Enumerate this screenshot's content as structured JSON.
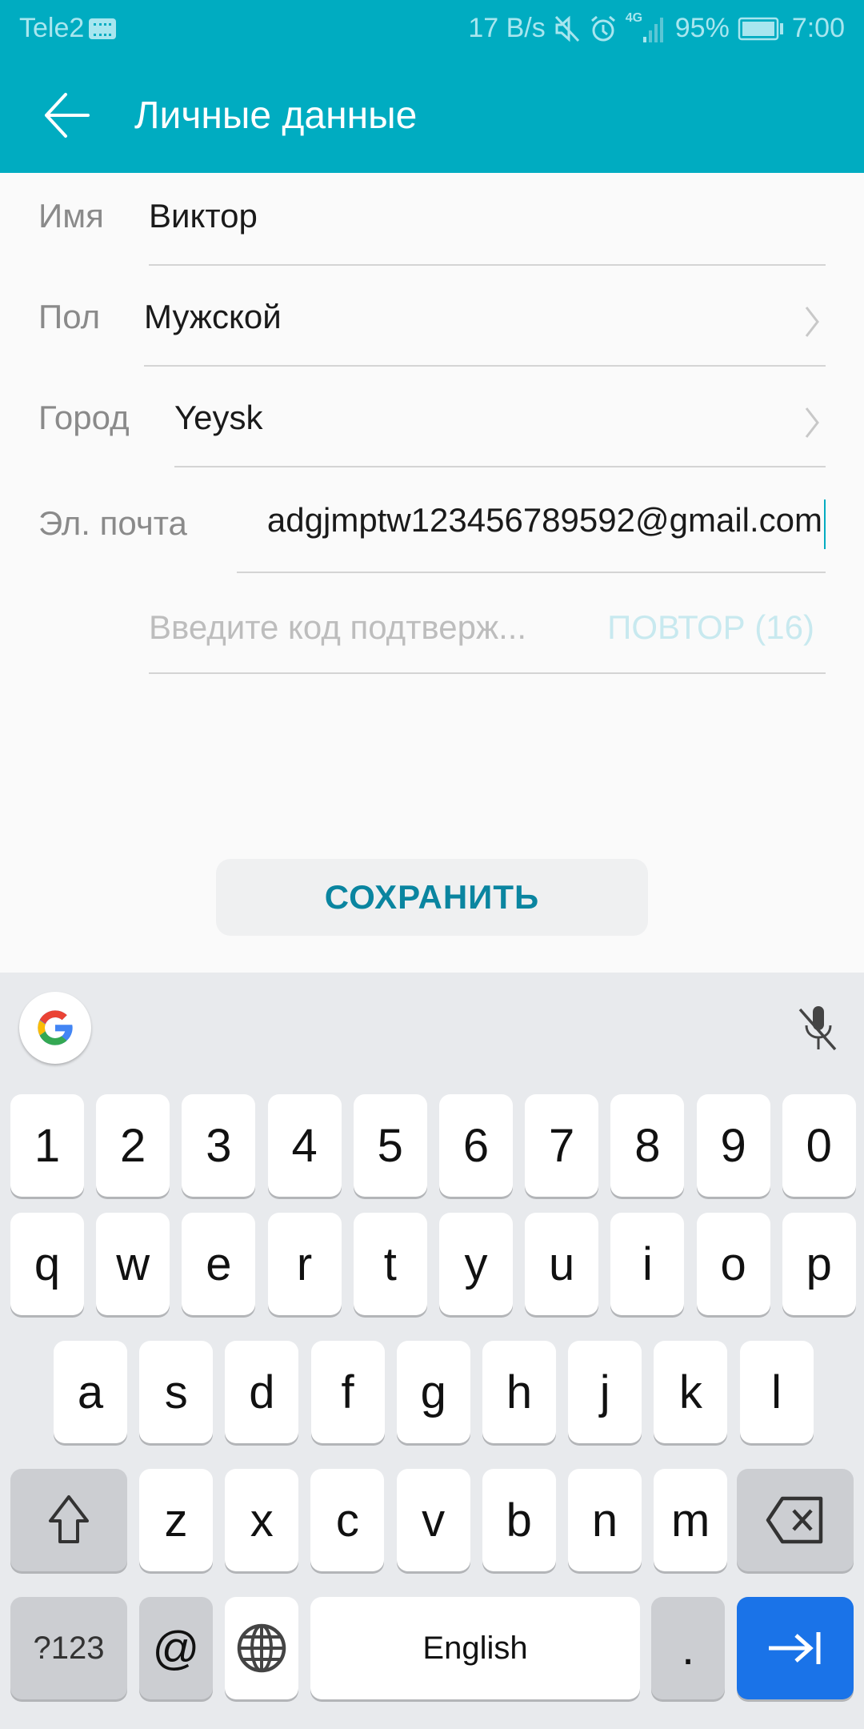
{
  "status_bar": {
    "carrier": "Tele2",
    "net_speed": "17 B/s",
    "network_type": "4G",
    "battery": "95%",
    "time": "7:00",
    "icons": [
      "keyboard-icon",
      "mute-icon",
      "alarm-icon",
      "signal-icon",
      "battery-icon"
    ]
  },
  "app_bar": {
    "title": "Личные данные",
    "back_icon": "arrow-left-icon"
  },
  "form": {
    "fields": [
      {
        "label": "Имя",
        "value": "Виктор"
      },
      {
        "label": "Пол",
        "value": "Мужской"
      },
      {
        "label": "Город",
        "value": "Yeysk"
      },
      {
        "label": "Эл. почта",
        "value": "adgjmptw123456789592@gmail.com"
      }
    ],
    "code_placeholder": "Введите код подтверж...",
    "resend_label": "ПОВТОР (16)"
  },
  "save_button": "СОХРАНИТЬ",
  "keyboard": {
    "row_numbers": [
      "1",
      "2",
      "3",
      "4",
      "5",
      "6",
      "7",
      "8",
      "9",
      "0"
    ],
    "row_1": [
      "q",
      "w",
      "e",
      "r",
      "t",
      "y",
      "u",
      "i",
      "o",
      "p"
    ],
    "row_2": [
      "a",
      "s",
      "d",
      "f",
      "g",
      "h",
      "j",
      "k",
      "l"
    ],
    "row_3": [
      "z",
      "x",
      "c",
      "v",
      "b",
      "n",
      "m"
    ],
    "symbols_key": "?123",
    "at_key": "@",
    "space_label": "English",
    "period_key": ".",
    "accent_color": "#1a73e8"
  },
  "colors": {
    "primary": "#00acc1",
    "save_text": "#0a85a0"
  }
}
